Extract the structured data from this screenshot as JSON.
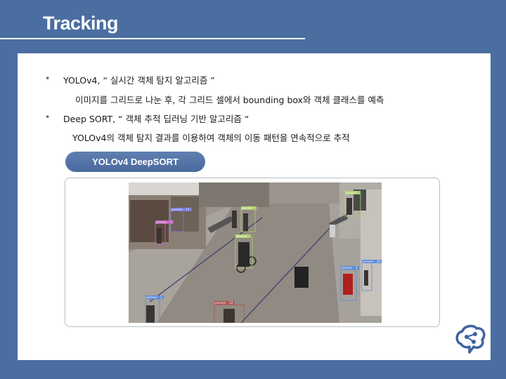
{
  "slide": {
    "title": "Tracking",
    "bullets": [
      {
        "marker": "•",
        "text": "YOLOv4, “ 실시간 객체 탐지 알고리즘 ”",
        "sub": "이미지를 그리드로 나눈 후, 각 그리드 셀에서 bounding box와 객체 클래스를 예측"
      },
      {
        "marker": "•",
        "text": "Deep SORT, “ 객체 추적 딥러닝 기반 알고리즘 “",
        "sub": "YOLOv4의 객체 탐지 결과를 이용하여 객체의 이동 패턴을 연속적으로 추적"
      }
    ],
    "demo_label": "YOLOv4 DeepSORT"
  },
  "detections": [
    {
      "label": "person - 17",
      "color": "#7a7ae0"
    },
    {
      "label": "person",
      "color": "#b0d070"
    },
    {
      "label": "person - 5",
      "color": "#c060c0"
    },
    {
      "label": "person",
      "color": "#b0d070"
    },
    {
      "label": "person",
      "color": "#b0d070"
    },
    {
      "label": "person - 3",
      "color": "#5a8ad8"
    },
    {
      "label": "person - 22",
      "color": "#5a8ad8"
    },
    {
      "label": "person - 1",
      "color": "#5a8ad8"
    },
    {
      "label": "person - 12",
      "color": "#b05050"
    }
  ],
  "colors": {
    "background": "#4a6ea0",
    "panel": "#ffffff",
    "pill": "#5576a8",
    "logo": "#3f63a0"
  },
  "icons": {
    "logo": "brain-network-icon"
  }
}
